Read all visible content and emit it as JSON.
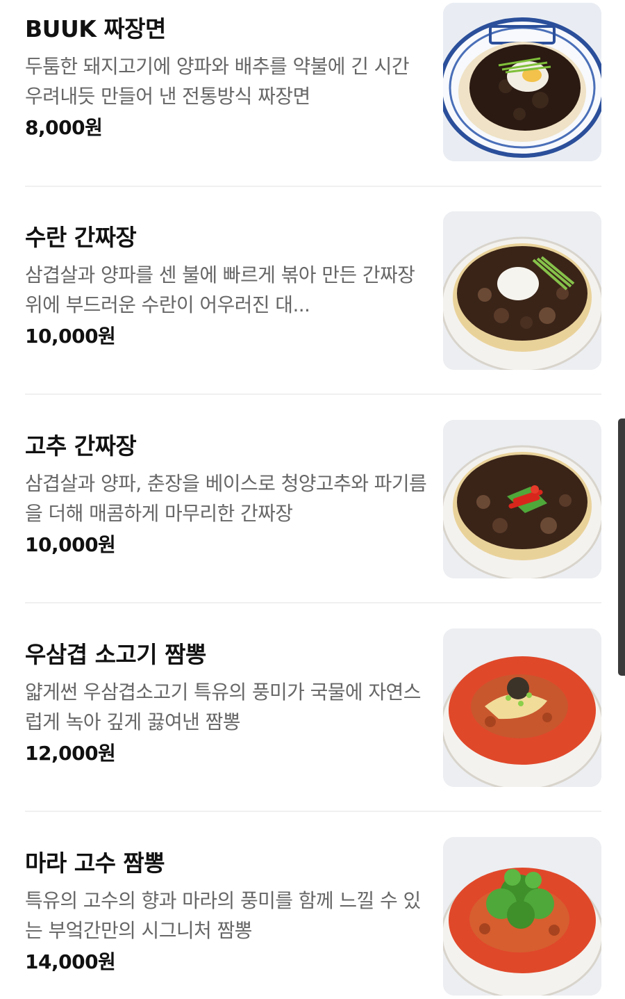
{
  "menu": {
    "items": [
      {
        "name": "BUUK 짜장면",
        "description": "두툼한 돼지고기에 양파와 배추를 약불에 긴 시간 우려내듯 만들어 낸 전통방식 짜장면",
        "price": "8,000원",
        "image_icon": "jjajangmyeon-photo-icon"
      },
      {
        "name": "수란 간짜장",
        "description": "삼겹살과 양파를 센 불에 빠르게 볶아 만든 간짜장위에 부드러운 수란이 어우러진 대...",
        "price": "10,000원",
        "image_icon": "suran-ganjjajang-photo-icon"
      },
      {
        "name": "고추 간짜장",
        "description": "삼겹살과 양파, 춘장을 베이스로 청양고추와 파기름을 더해 매콤하게 마무리한 간짜장",
        "price": "10,000원",
        "image_icon": "gochu-ganjjajang-photo-icon"
      },
      {
        "name": "우삼겹 소고기 짬뽕",
        "description": "얇게썬 우삼겹소고기 특유의 풍미가 국물에 자연스럽게 녹아 깊게 끓여낸 짬뽕",
        "price": "12,000원",
        "image_icon": "beef-jjamppong-photo-icon"
      },
      {
        "name": "마라 고수 짬뽕",
        "description": "특유의 고수의 향과 마라의 풍미를 함께 느낄 수 있는 부엌간만의 시그니처 짬뽕",
        "price": "14,000원",
        "image_icon": "mala-coriander-jjamppong-photo-icon"
      }
    ]
  },
  "colors": {
    "title_text": "#111111",
    "description_text": "#666666",
    "price_text": "#111111",
    "divider": "#f0f0f0",
    "thumb_background": "#eef0f3",
    "scrollbar": "#3b3b3b"
  }
}
